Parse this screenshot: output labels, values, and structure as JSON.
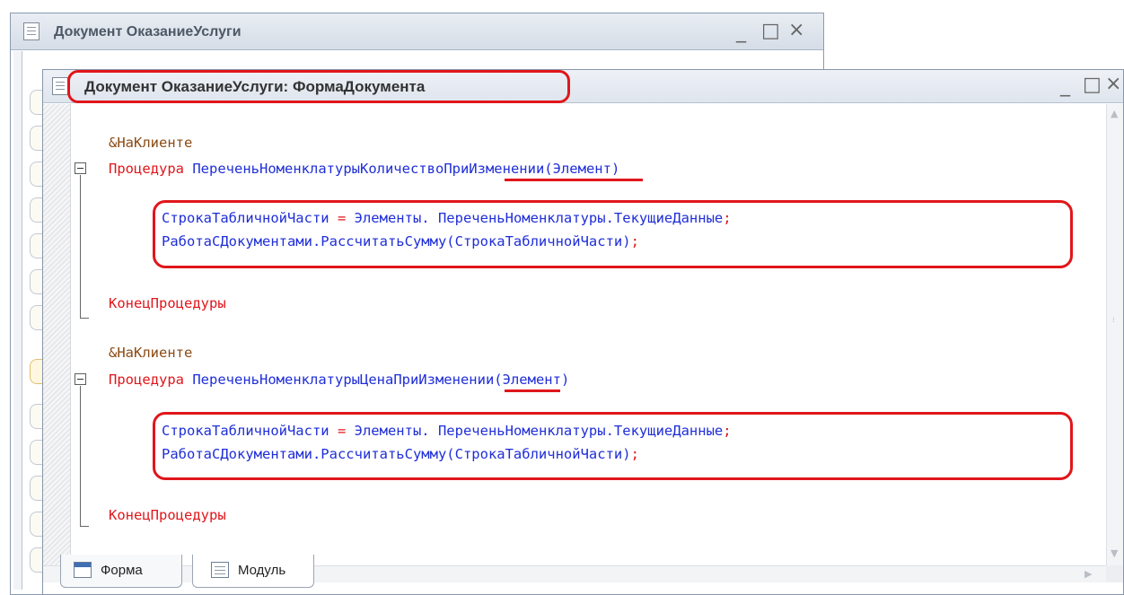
{
  "outer_window": {
    "title": "Документ ОказаниеУслуги",
    "buttons": {
      "minimize": "_",
      "maximize": "□",
      "close": "×"
    }
  },
  "inner_window": {
    "title": "Документ ОказаниеУслуги: ФормаДокумента",
    "buttons": {
      "minimize": "_",
      "maximize": "□",
      "close": "×"
    }
  },
  "code": {
    "proc1": {
      "directive": "&НаКлиенте",
      "keyword": "Процедура",
      "name_prefix": "ПереченьНоменклатуры",
      "name_highlight": "Количество",
      "name_suffix": "ПриИзменении",
      "params": "(Элемент)",
      "line1_var": "СтрокаТабличнойЧасти",
      "line1_op": " = ",
      "line1_expr": "Элементы. ПереченьНоменклатуры.ТекущиеДанные",
      "line1_end": ";",
      "line2_expr": "РаботаСДокументами.РассчитатьСумму(СтрокаТабличнойЧасти)",
      "line2_end": ";",
      "end": "КонецПроцедуры"
    },
    "proc2": {
      "directive": "&НаКлиенте",
      "keyword": "Процедура",
      "name_prefix": "ПереченьНоменклатуры",
      "name_highlight": "Цена",
      "name_suffix": "ПриИзменении",
      "params": "(Элемент)",
      "line1_var": "СтрокаТабличнойЧасти",
      "line1_op": " = ",
      "line1_expr": "Элементы. ПереченьНоменклатуры.ТекущиеДанные",
      "line1_end": ";",
      "line2_expr": "РаботаСДокументами.РассчитатьСумму(СтрокаТабличнойЧасти)",
      "line2_end": ";",
      "end": "КонецПроцедуры"
    }
  },
  "tabs": [
    {
      "label": "Форма",
      "icon": "form-icon"
    },
    {
      "label": "Модуль",
      "icon": "module-icon"
    }
  ],
  "colors": {
    "annotation": "#e0161b",
    "identifier": "#1f2ed8",
    "keyword": "#e0161b",
    "directive": "#8b4a14"
  }
}
